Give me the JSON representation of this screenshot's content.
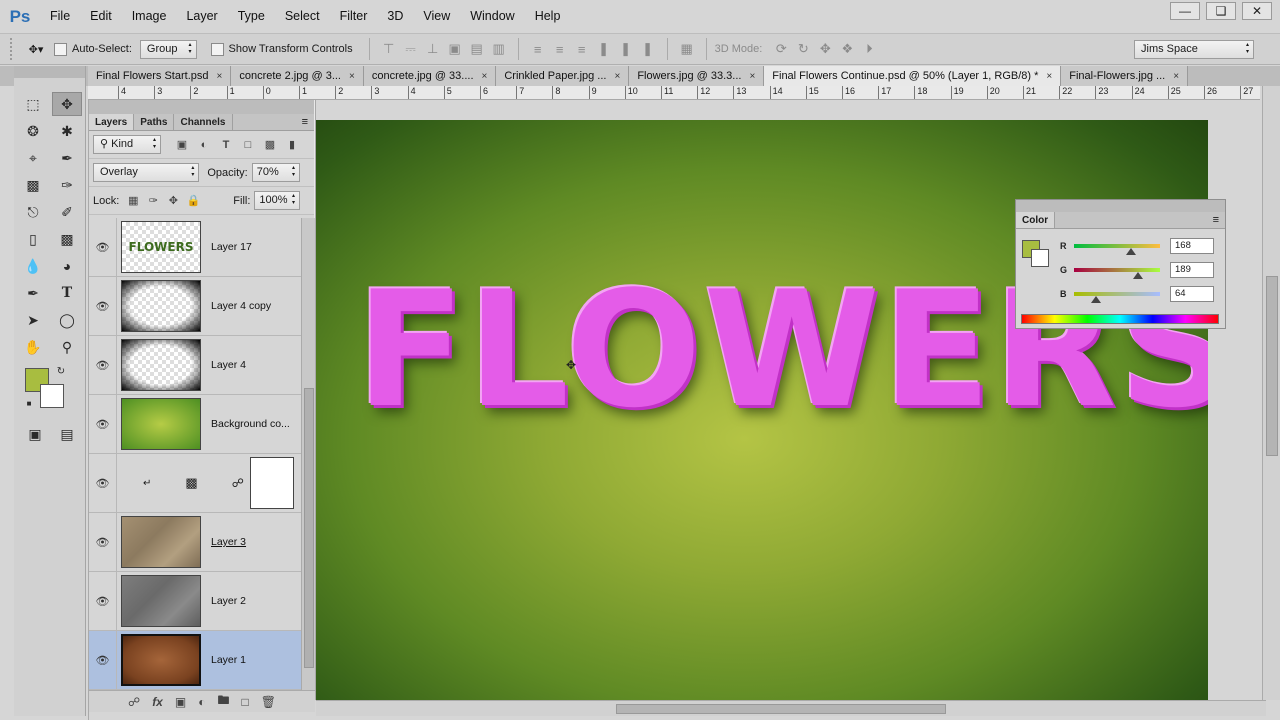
{
  "menu": {
    "logo": "Ps",
    "items": [
      "File",
      "Edit",
      "Image",
      "Layer",
      "Type",
      "Select",
      "Filter",
      "3D",
      "View",
      "Window",
      "Help"
    ]
  },
  "options_bar": {
    "auto_select_label": "Auto-Select:",
    "auto_select_value": "Group",
    "transform_label": "Show Transform Controls",
    "mode_3d_label": "3D Mode:",
    "workspace": "Jims Space"
  },
  "tabs": [
    {
      "label": "Final Flowers Start.psd",
      "active": false
    },
    {
      "label": "concrete 2.jpg @ 3...",
      "active": false
    },
    {
      "label": "concrete.jpg @ 33....",
      "active": false
    },
    {
      "label": "Crinkled Paper.jpg ...",
      "active": false
    },
    {
      "label": "Flowers.jpg @ 33.3...",
      "active": false
    },
    {
      "label": "Final Flowers Continue.psd @ 50% (Layer 1, RGB/8) *",
      "active": true
    },
    {
      "label": "Final-Flowers.jpg ...",
      "active": false
    }
  ],
  "ruler": {
    "ticks": [
      "4",
      "3",
      "2",
      "1",
      "0",
      "1",
      "2",
      "3",
      "4",
      "5",
      "6",
      "7",
      "8",
      "9",
      "10",
      "11",
      "12",
      "13",
      "14",
      "15",
      "16",
      "17",
      "18",
      "19",
      "20",
      "21",
      "22",
      "23",
      "24",
      "25",
      "26",
      "27"
    ]
  },
  "layers_panel": {
    "tabs": [
      "Layers",
      "Paths",
      "Channels"
    ],
    "filter_kind": "Kind",
    "blend_mode": "Overlay",
    "opacity_label": "Opacity:",
    "opacity_value": "70%",
    "lock_label": "Lock:",
    "fill_label": "Fill:",
    "fill_value": "100%",
    "layers": [
      {
        "name": "Layer 17",
        "thumb_text": "FLOWERS",
        "selected": false
      },
      {
        "name": "Layer 4 copy",
        "thumb_text": "",
        "selected": false
      },
      {
        "name": "Layer 4",
        "thumb_text": "",
        "selected": false
      },
      {
        "name": "Background co...",
        "thumb_text": "",
        "selected": false
      },
      {
        "name": "",
        "thumb_text": "",
        "selected": false
      },
      {
        "name": "Layer 3",
        "thumb_text": "",
        "selected": false
      },
      {
        "name": "Layer 2",
        "thumb_text": "",
        "selected": false
      },
      {
        "name": "Layer 1",
        "thumb_text": "",
        "selected": true
      }
    ]
  },
  "canvas": {
    "art_text": "FLOWERS"
  },
  "color_panel": {
    "title": "Color",
    "r_label": "R",
    "g_label": "G",
    "b_label": "B",
    "r": "168",
    "g": "189",
    "b": "64",
    "foreground": "#a8bd40",
    "background": "#ffffff"
  }
}
